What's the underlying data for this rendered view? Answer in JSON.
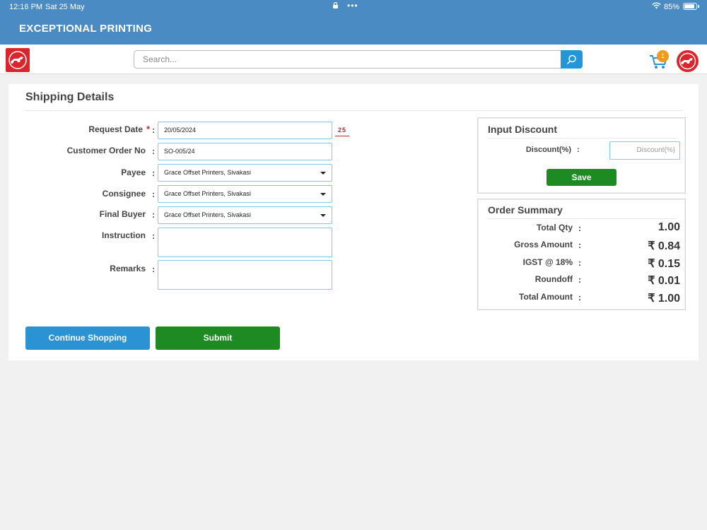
{
  "status_bar": {
    "time": "12:16 PM",
    "date": "Sat 25 May",
    "dots": "•••",
    "battery": "85%"
  },
  "app": {
    "title": "EXCEPTIONAL PRINTING"
  },
  "search": {
    "placeholder": "Search..."
  },
  "cart": {
    "count": "1"
  },
  "form": {
    "title": "Shipping Details",
    "request_date": {
      "label": "Request Date",
      "required_mark": "*",
      "value": "20/05/2024",
      "calendar_text": "25"
    },
    "customer_order_no": {
      "label": "Customer Order No",
      "value": "SO-005/24"
    },
    "payee": {
      "label": "Payee",
      "value": "Grace Offset Printers, Sivakasi"
    },
    "consignee": {
      "label": "Consignee",
      "value": "Grace Offset Printers, Sivakasi"
    },
    "final_buyer": {
      "label": "Final Buyer",
      "value": "Grace Offset Printers, Sivakasi"
    },
    "instruction": {
      "label": "Instruction",
      "value": ""
    },
    "remarks": {
      "label": "Remarks",
      "value": ""
    },
    "colon": ":"
  },
  "buttons": {
    "continue_shopping": "Continue Shopping",
    "submit": "Submit"
  },
  "discount_panel": {
    "title": "Input Discount",
    "label": "Discount(%)",
    "colon": ":",
    "placeholder": "Discount(%)",
    "save": "Save"
  },
  "order_summary": {
    "title": "Order Summary",
    "colon": ":",
    "rows": [
      {
        "label": "Total Qty",
        "value": "1.00"
      },
      {
        "label": "Gross Amount",
        "value": "₹ 0.84"
      },
      {
        "label": "IGST @ 18%",
        "value": "₹ 0.15"
      },
      {
        "label": "Roundoff",
        "value": "₹ 0.01"
      },
      {
        "label": "Total Amount",
        "value": "₹ 1.00"
      }
    ]
  },
  "colors": {
    "header": "#4a8bc4",
    "primary_blue": "#2b93d4",
    "green": "#1e8a22",
    "brand_red": "#d9252b",
    "badge": "#f19a1e"
  }
}
